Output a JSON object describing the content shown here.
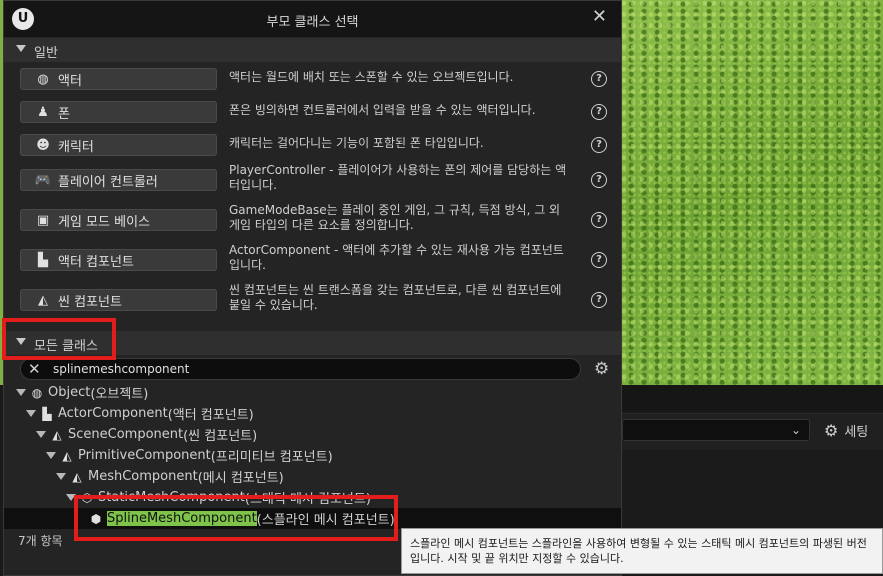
{
  "dialog": {
    "title": "부모 클래스 선택"
  },
  "sections": {
    "common": "일반",
    "all_classes": "모든 클래스"
  },
  "common_classes": [
    {
      "label": "액터",
      "icon": "actor-sphere-icon",
      "desc": "액터는 월드에 배치 또는 스폰할 수 있는 오브젝트입니다."
    },
    {
      "label": "폰",
      "icon": "pawn-icon",
      "desc": "폰은 빙의하면 컨트롤러에서 입력을 받을 수 있는 액터입니다."
    },
    {
      "label": "캐릭터",
      "icon": "character-icon",
      "desc": "캐릭터는 걸어다니는 기능이 포함된 폰 타입입니다."
    },
    {
      "label": "플레이어 컨트롤러",
      "icon": "gamepad-icon",
      "desc": "PlayerController - 플레이어가 사용하는 폰의 제어를 담당하는 액터입니다."
    },
    {
      "label": "게임 모드 베이스",
      "icon": "game-mode-icon",
      "desc": "GameModeBase는 플레이 중인 게임, 그 규칙, 득점 방식, 그 외 게임 타입의 다른 요소를 정의합니다."
    },
    {
      "label": "액터 컴포넌트",
      "icon": "actor-component-icon",
      "desc": "ActorComponent - 액터에 추가할 수 있는 재사용 가능 컴포넌트입니다."
    },
    {
      "label": "씬 컴포넌트",
      "icon": "scene-component-icon",
      "desc": "씬 컴포넌트는 씬 트랜스폼을 갖는 컴포넌트로, 다른 씬 컴포넌트에 붙일 수 있습니다."
    }
  ],
  "search": {
    "value": "splinemeshcomponent"
  },
  "tree": [
    {
      "name": "Object",
      "suffix": " (오브젝트)"
    },
    {
      "name": "ActorComponent",
      "suffix": " (액터 컴포넌트)"
    },
    {
      "name": "SceneComponent",
      "suffix": " (씬 컴포넌트)"
    },
    {
      "name": "PrimitiveComponent",
      "suffix": " (프리미티브 컴포넌트)"
    },
    {
      "name": "MeshComponent",
      "suffix": " (메시 컴포넌트)"
    },
    {
      "name": "StaticMeshComponent",
      "suffix": " (스태틱 메시 컴포넌트)"
    },
    {
      "name": "SplineMeshComponent",
      "suffix": " (스플라인 메시 컴포넌트)"
    }
  ],
  "item_count": "7개 항목",
  "tooltip": "스플라인 메시 컴포넌트는 스플라인을 사용하여 변형될 수 있는 스태틱 메시 컴포넌트의 파생된 버전입니다. 시작 및 끝 위치만 지정할 수 있습니다.",
  "background": {
    "settings_label": "세팅"
  },
  "colors": {
    "highlight": "#7fc44a",
    "annotation_red": "#e31c1c",
    "dialog_bg": "#242424"
  }
}
